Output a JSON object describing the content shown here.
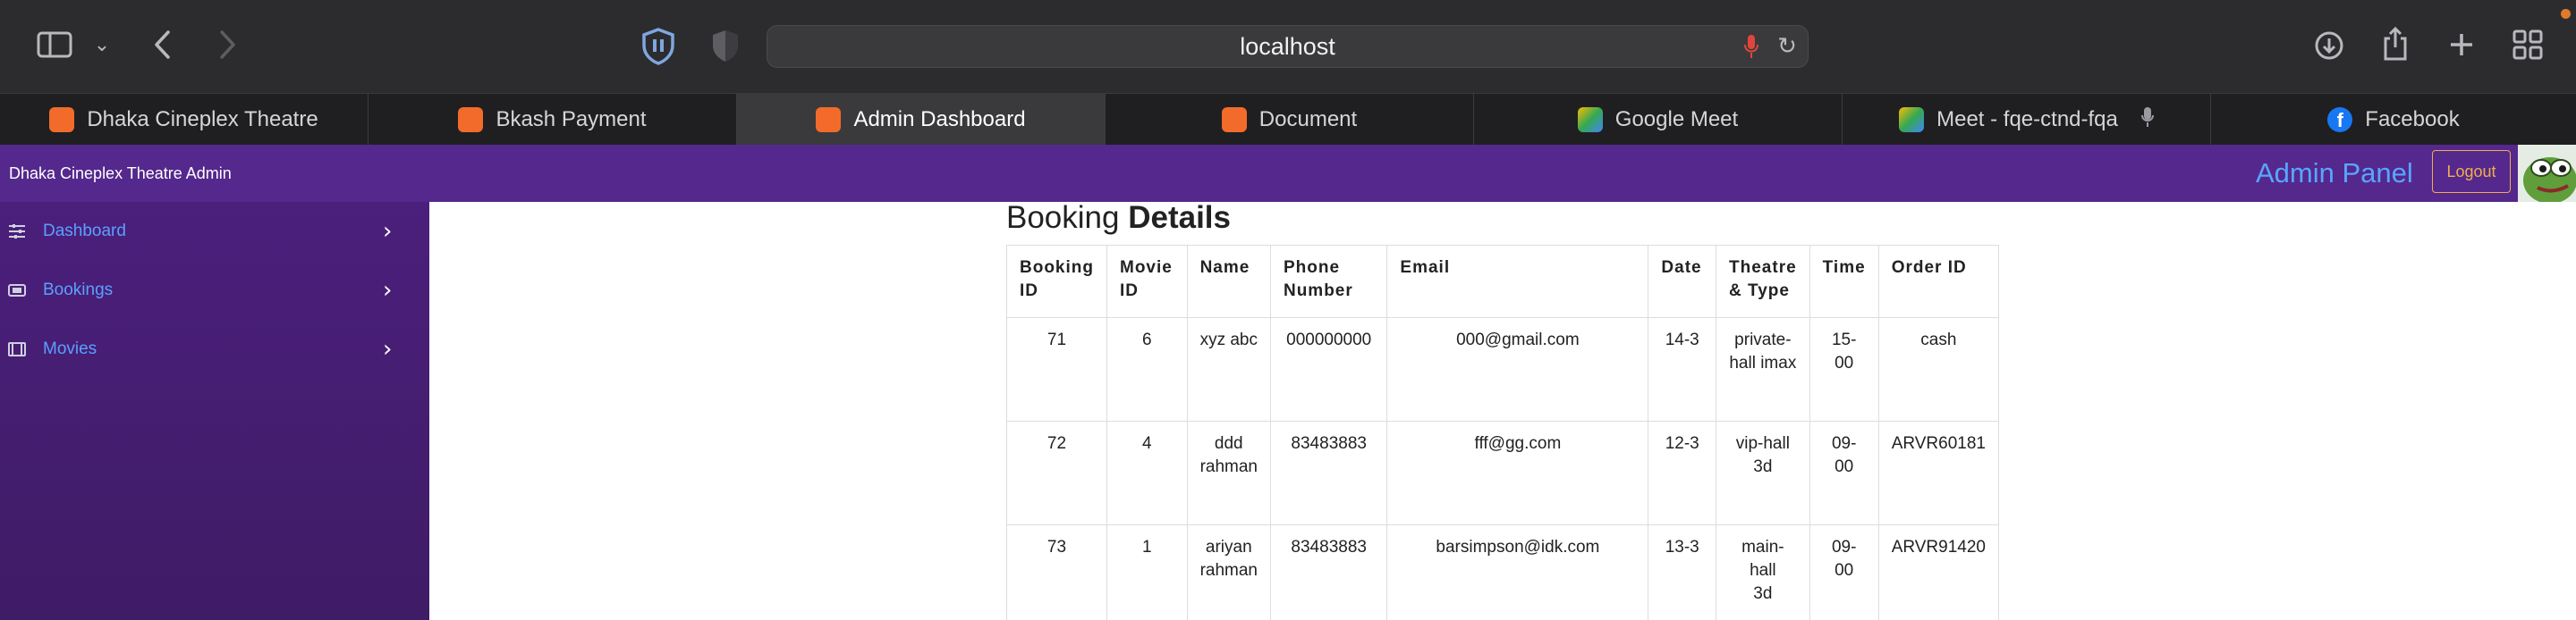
{
  "browser": {
    "url": "localhost",
    "tabs": [
      {
        "label": "Dhaka Cineplex Theatre",
        "icon": "xampp-icon",
        "color": "#f26b2a"
      },
      {
        "label": "Bkash Payment",
        "icon": "xampp-icon",
        "color": "#f26b2a"
      },
      {
        "label": "Admin Dashboard",
        "icon": "xampp-icon",
        "color": "#f26b2a",
        "active": true
      },
      {
        "label": "Document",
        "icon": "xampp-icon",
        "color": "#f26b2a"
      },
      {
        "label": "Google Meet",
        "icon": "google-meet-icon",
        "color": "#00897b"
      },
      {
        "label": "Meet - fqe-ctnd-fqa",
        "icon": "google-meet-icon",
        "color": "#00897b"
      },
      {
        "label": "Facebook",
        "icon": "facebook-icon",
        "color": "#1877f2"
      }
    ]
  },
  "header": {
    "brand": "Dhaka Cineplex Theatre Admin",
    "panel_title": "Admin Panel",
    "logout_label": "Logout",
    "accent": "#55288d"
  },
  "sidebar": {
    "items": [
      {
        "label": "Dashboard",
        "icon": "sliders-icon"
      },
      {
        "label": "Bookings",
        "icon": "ticket-icon"
      },
      {
        "label": "Movies",
        "icon": "film-icon"
      }
    ]
  },
  "main": {
    "title_part1": "Booking",
    "title_part2": "Details",
    "columns": [
      {
        "line1": "Booking",
        "line2": "ID"
      },
      {
        "line1": "Movie",
        "line2": "ID"
      },
      {
        "line1": "Name",
        "line2": ""
      },
      {
        "line1": "Phone",
        "line2": "Number"
      },
      {
        "line1": "Email",
        "line2": ""
      },
      {
        "line1": "Date",
        "line2": ""
      },
      {
        "line1": "Theatre",
        "line2": "& Type"
      },
      {
        "line1": "Time",
        "line2": ""
      },
      {
        "line1": "Order ID",
        "line2": ""
      }
    ],
    "rows": [
      {
        "booking_id": "71",
        "movie_id": "6",
        "name1": "xyz abc",
        "name2": "",
        "phone": "000000000",
        "email": "000@gmail.com",
        "date": "14-3",
        "theatre1": "private-",
        "theatre2": "hall imax",
        "time1": "15-",
        "time2": "00",
        "order_id": "cash"
      },
      {
        "booking_id": "72",
        "movie_id": "4",
        "name1": "ddd",
        "name2": "rahman",
        "phone": "83483883",
        "email": "fff@gg.com",
        "date": "12-3",
        "theatre1": "vip-hall",
        "theatre2": "3d",
        "time1": "09-",
        "time2": "00",
        "order_id": "ARVR60181"
      },
      {
        "booking_id": "73",
        "movie_id": "1",
        "name1": "ariyan",
        "name2": "rahman",
        "phone": "83483883",
        "email": "barsimpson@idk.com",
        "date": "13-3",
        "theatre1": "main-hall",
        "theatre2": "3d",
        "time1": "09-",
        "time2": "00",
        "order_id": "ARVR91420"
      }
    ]
  }
}
